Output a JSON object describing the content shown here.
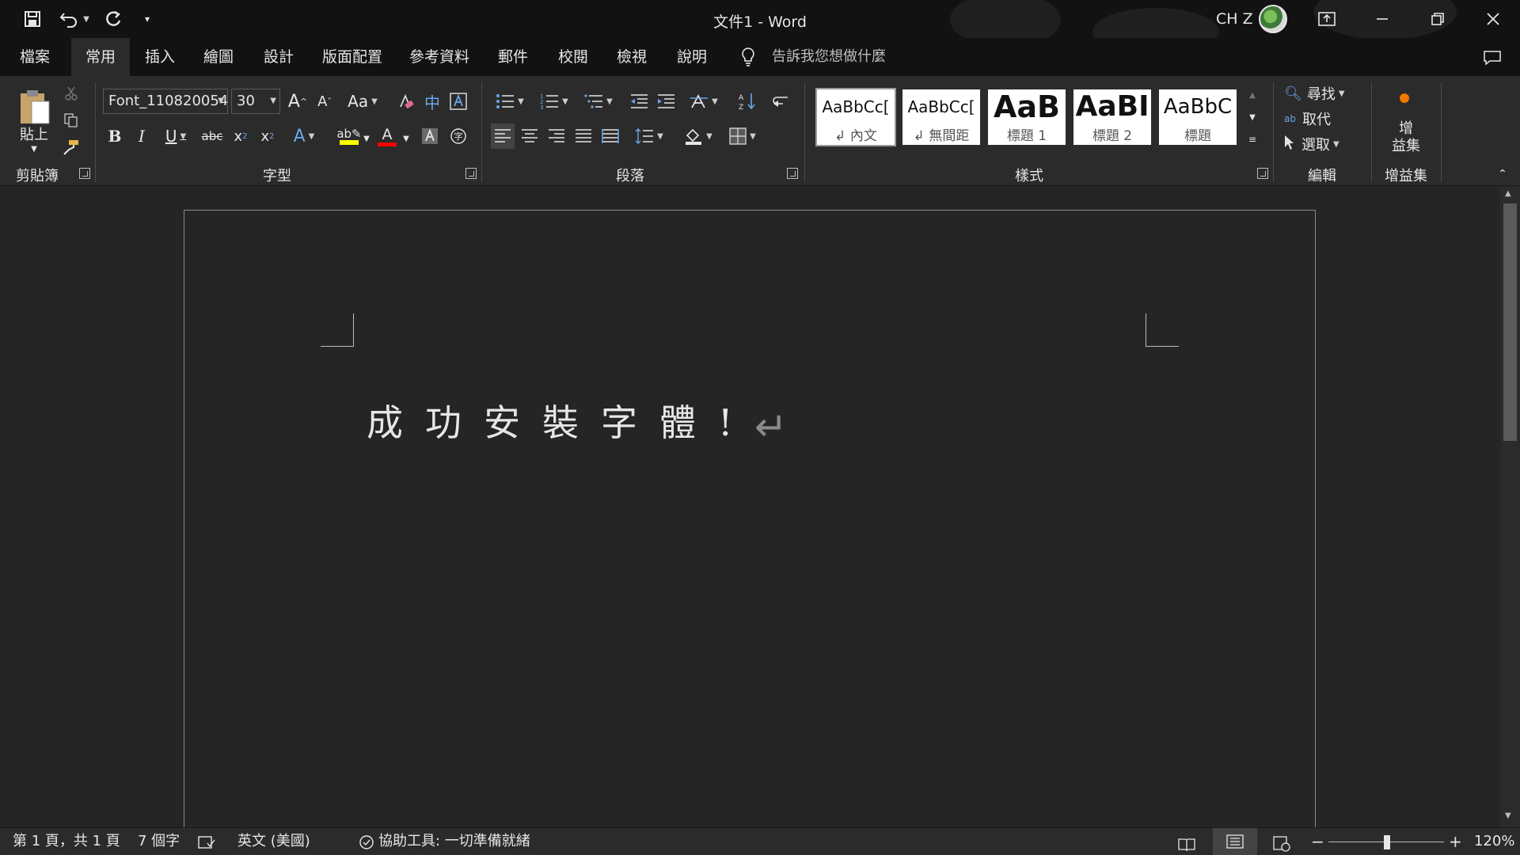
{
  "window": {
    "doc_title": "文件1  -  Word",
    "username": "CH Z"
  },
  "qat": {
    "save_icon": "save-icon",
    "undo_icon": "undo-icon",
    "redo_icon": "redo-icon",
    "customize_icon": "customize-qat-icon"
  },
  "tabs": [
    "檔案",
    "常用",
    "插入",
    "繪圖",
    "設計",
    "版面配置",
    "參考資料",
    "郵件",
    "校閱",
    "檢視",
    "說明"
  ],
  "active_tab": "常用",
  "tell_me": "告訴我您想做什麼",
  "ribbon": {
    "clipboard": {
      "label": "剪貼簿",
      "paste": "貼上"
    },
    "font": {
      "label": "字型",
      "font_name": "Font_110820054",
      "font_size": "30",
      "change_case": "Aa"
    },
    "paragraph": {
      "label": "段落"
    },
    "styles": {
      "label": "樣式",
      "items": [
        {
          "sample": "AaBbCc[",
          "name": "↲ 內文"
        },
        {
          "sample": "AaBbCc[",
          "name": "↲ 無間距"
        },
        {
          "sample": "AaB",
          "name": "標題 1"
        },
        {
          "sample": "AaBI",
          "name": "標題 2"
        },
        {
          "sample": "AaBbC",
          "name": "標題"
        }
      ]
    },
    "editing": {
      "label": "編輯",
      "find": "尋找",
      "replace": "取代",
      "select": "選取"
    },
    "addins": {
      "label": "增益集",
      "button": "增\n益集"
    }
  },
  "document": {
    "text": "成功安裝字體!",
    "paragraph_mark": "↵"
  },
  "statusbar": {
    "page": "第 1 頁，共 1 頁",
    "words": "7 個字",
    "language": "英文 (美國)",
    "accessibility": "協助工具: 一切準備就緒",
    "zoom": "120%"
  },
  "colors": {
    "titlebar": "#121212",
    "ribbon": "#2b2b2b",
    "canvas": "#252525",
    "highlight_yellow": "#ffff00",
    "font_color_red": "#ff0000",
    "addins_dot": "#f07800"
  }
}
